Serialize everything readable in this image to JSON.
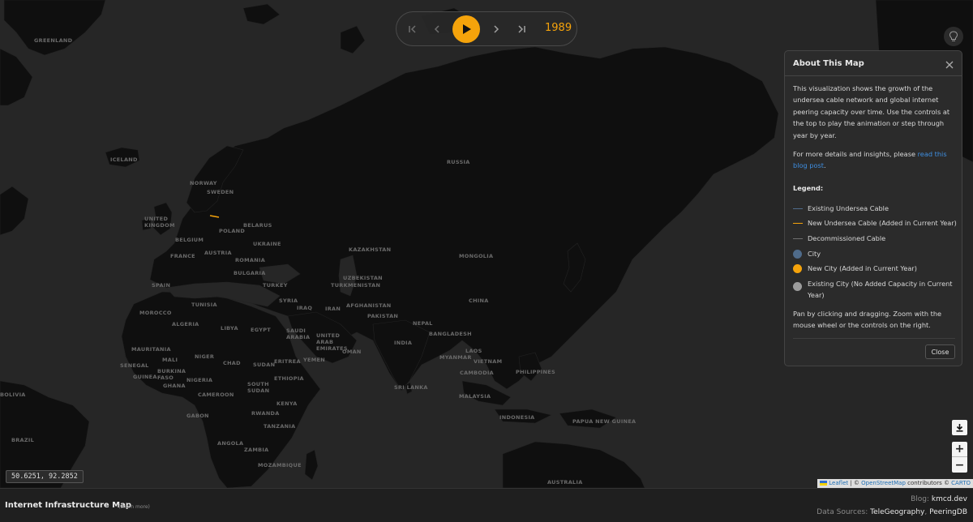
{
  "player": {
    "year": "1989",
    "buttons": {
      "first": "first-year",
      "prev": "previous-year",
      "play": "play",
      "next": "next-year",
      "last": "last-year"
    }
  },
  "map": {
    "labels": [
      {
        "text": "GREENLAND",
        "id": "greenland"
      },
      {
        "text": "ICELAND",
        "id": "iceland"
      },
      {
        "text": "NORWAY",
        "id": "norway"
      },
      {
        "text": "SWEDEN",
        "id": "sweden"
      },
      {
        "text": "UNITED KINGDOM",
        "id": "uk"
      },
      {
        "text": "BELARUS",
        "id": "belarus"
      },
      {
        "text": "POLAND",
        "id": "poland"
      },
      {
        "text": "BELGIUM",
        "id": "belgium"
      },
      {
        "text": "UKRAINE",
        "id": "ukraine"
      },
      {
        "text": "FRANCE",
        "id": "france"
      },
      {
        "text": "AUSTRIA",
        "id": "austria"
      },
      {
        "text": "ROMANIA",
        "id": "romania"
      },
      {
        "text": "BULGARIA",
        "id": "bulgaria"
      },
      {
        "text": "SPAIN",
        "id": "spain"
      },
      {
        "text": "TURKEY",
        "id": "turkey"
      },
      {
        "text": "RUSSIA",
        "id": "russia"
      },
      {
        "text": "KAZAKHSTAN",
        "id": "kazakhstan"
      },
      {
        "text": "MONGOLIA",
        "id": "mongolia"
      },
      {
        "text": "UZBEKISTAN",
        "id": "uzbekistan"
      },
      {
        "text": "TURKMENISTAN",
        "id": "turkmenistan"
      },
      {
        "text": "AFGHANISTAN",
        "id": "afghanistan"
      },
      {
        "text": "CHINA",
        "id": "china"
      },
      {
        "text": "IRAN",
        "id": "iran"
      },
      {
        "text": "IRAQ",
        "id": "iraq"
      },
      {
        "text": "SYRIA",
        "id": "syria"
      },
      {
        "text": "PAKISTAN",
        "id": "pakistan"
      },
      {
        "text": "NEPAL",
        "id": "nepal"
      },
      {
        "text": "INDIA",
        "id": "india"
      },
      {
        "text": "BANGLADESH",
        "id": "bangladesh"
      },
      {
        "text": "MYANMAR",
        "id": "myanmar"
      },
      {
        "text": "LAOS",
        "id": "laos"
      },
      {
        "text": "VIETNAM",
        "id": "vietnam"
      },
      {
        "text": "CAMBODIA",
        "id": "cambodia"
      },
      {
        "text": "PHILIPPINES",
        "id": "philippines"
      },
      {
        "text": "MALAYSIA",
        "id": "malaysia"
      },
      {
        "text": "INDONESIA",
        "id": "indonesia"
      },
      {
        "text": "PAPUA NEW GUINEA",
        "id": "png"
      },
      {
        "text": "AUSTRALIA",
        "id": "australia"
      },
      {
        "text": "SRI LANKA",
        "id": "srilanka"
      },
      {
        "text": "MOROCCO",
        "id": "morocco"
      },
      {
        "text": "ALGERIA",
        "id": "algeria"
      },
      {
        "text": "TUNISIA",
        "id": "tunisia"
      },
      {
        "text": "LIBYA",
        "id": "libya"
      },
      {
        "text": "EGYPT",
        "id": "egypt"
      },
      {
        "text": "SAUDI ARABIA",
        "id": "saudi"
      },
      {
        "text": "YEMEN",
        "id": "yemen"
      },
      {
        "text": "OMAN",
        "id": "oman"
      },
      {
        "text": "UNITED ARAB EMIRATES",
        "id": "uae"
      },
      {
        "text": "MAURITANIA",
        "id": "mauritania"
      },
      {
        "text": "MALI",
        "id": "mali"
      },
      {
        "text": "NIGER",
        "id": "niger"
      },
      {
        "text": "CHAD",
        "id": "chad"
      },
      {
        "text": "SUDAN",
        "id": "sudan"
      },
      {
        "text": "ERITREA",
        "id": "eritrea"
      },
      {
        "text": "ETHIOPIA",
        "id": "ethiopia"
      },
      {
        "text": "SENEGAL",
        "id": "senegal"
      },
      {
        "text": "GUINEA",
        "id": "guinea"
      },
      {
        "text": "BURKINA FASO",
        "id": "burkina"
      },
      {
        "text": "NIGERIA",
        "id": "nigeria"
      },
      {
        "text": "GHANA",
        "id": "ghana"
      },
      {
        "text": "CAMEROON",
        "id": "cameroon"
      },
      {
        "text": "SOUTH SUDAN",
        "id": "southsudan"
      },
      {
        "text": "KENYA",
        "id": "kenya"
      },
      {
        "text": "RWANDA",
        "id": "rwanda"
      },
      {
        "text": "TANZANIA",
        "id": "tanzania"
      },
      {
        "text": "ANGOLA",
        "id": "angola"
      },
      {
        "text": "ZAMBIA",
        "id": "zambia"
      },
      {
        "text": "MOZAMBIQUE",
        "id": "mozambique"
      },
      {
        "text": "GABON",
        "id": "gabon"
      },
      {
        "text": "BRAZIL",
        "id": "brazil"
      },
      {
        "text": "BOLIVIA",
        "id": "bolivia"
      }
    ]
  },
  "about": {
    "title": "About This Map",
    "paragraph1": "This visualization shows the growth of the undersea cable network and global internet peering capacity over time. Use the controls at the top to play the animation or step through year by year.",
    "paragraph2_prefix": "For more details and insights, please ",
    "paragraph2_link": "read this blog post",
    "paragraph2_suffix": ".",
    "legend_title": "Legend:",
    "legend": [
      {
        "label": "Existing Undersea Cable",
        "kind": "line",
        "color": "#4f6b8a"
      },
      {
        "label": "New Undersea Cable (Added in Current Year)",
        "kind": "line",
        "color": "#f5a30b"
      },
      {
        "label": "Decommissioned Cable",
        "kind": "line",
        "color": "#6e6e6e"
      },
      {
        "label": "City",
        "kind": "dot",
        "color": "#4f6b8a"
      },
      {
        "label": "New City (Added in Current Year)",
        "kind": "dot",
        "color": "#f5a30b"
      },
      {
        "label": "Existing City (No Added Capacity in Current Year)",
        "kind": "dot",
        "color": "#9c9c9c"
      }
    ],
    "paragraph3": "Pan by clicking and dragging. Zoom with the mouse wheel or the controls on the right.",
    "close_label": "Close"
  },
  "coords": "50.6251, 92.2852",
  "attribution": {
    "leaflet": "Leaflet",
    "sep": " | © ",
    "osm": "OpenStreetMap",
    "contributors": " contributors © ",
    "carto": "CARTO"
  },
  "footer": {
    "title": "Internet Infrastructure Map",
    "learn_more": "(Learn more)",
    "blog_label": "Blog: ",
    "blog_value": "kmcd.dev",
    "sources_label": "Data Sources: ",
    "source1": "TeleGeography",
    "sources_sep": ", ",
    "source2": "PeeringDB"
  },
  "colors": {
    "accent": "#f5a30b",
    "link": "#3e8ee0",
    "land": "#0f0f0f",
    "water": "#262626"
  }
}
